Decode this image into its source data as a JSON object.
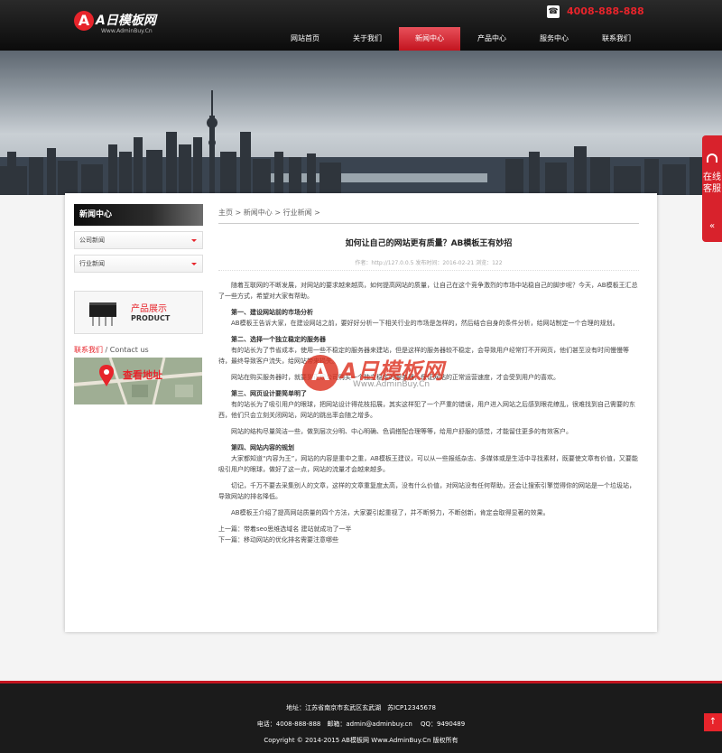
{
  "header": {
    "logo_mark": "A",
    "logo_name": "A日模板网",
    "logo_url": "Www.AdminBuy.Cn",
    "phone": "4008-888-888",
    "nav": [
      "网站首页",
      "关于我们",
      "新闻中心",
      "产品中心",
      "服务中心",
      "联系我们"
    ],
    "nav_active_index": 2
  },
  "sidebar": {
    "title": "新闻中心",
    "items": [
      "公司新闻",
      "行业新闻"
    ],
    "product_label_cn": "产品展示",
    "product_label_en": "PRODUCT",
    "contact_red": "联系我们",
    "contact_rest": " / Contact us",
    "map_label": "查看地址"
  },
  "article": {
    "breadcrumb": "主页 > 新闻中心 > 行业新闻 >",
    "title": "如何让自己的网站更有质量？AB模板王有妙招",
    "meta": "作者：http://127.0.0.5  发布时间：2016-02-21  浏览：122",
    "paragraphs": [
      "随着互联网的不断发展，对网站的要求越来越高，如何提高网站的质量，让自己在这个竞争激烈的市场中站稳自己的脚步呢？今天，AB模板王汇总了一些方式，希望对大家有帮助。",
      "第一、建设网站前的市场分析",
      "AB模板王告诉大家，在建设网站之前，要好好分析一下相关行业的市场是怎样的，然后结合自身的条件分析，给网站制定一个合理的规划。",
      "第二、选择一个独立稳定的服务器",
      "有的站长为了节省成本，使用一些不稳定的服务器来建站，但是这样的服务器较不稳定，会导致用户经常打不开网页，他们甚至没有时间慢慢等待，最终导致客户流失，给网站带来损失。",
      "网站在购买服务器时，就要到正规公司购买一个独立稳定的服务器，保证网站的正常运营速度，才会受到用户的喜欢。",
      "第三、网页设计要简单明了",
      "有的站长为了吸引用户的眼球，把网站设计得花枝招展，其实这样犯了一个严重的错误，用户进入网站之后感到眼花缭乱，很难找到自己需要的东西，他们只会立刻关闭网站，网站的跳出率会随之增多。",
      "网站的结构尽量简洁一些，做到层次分明、中心明确、色调搭配合理等等，给用户舒服的感觉，才能留住更多的有效客户。",
      "第四、网站内容的规划",
      "大家都知道“内容为王”，网站的内容是重中之重，AB模板王建议，可以从一些报纸杂志、多媒体或是生活中寻找素材，既要使文章有价值，又要能吸引用户的眼球，做好了这一点，网站的流量才会越来越多。",
      "切记，千万不要去采集别人的文章，这样的文章重复度太高，没有什么价值，对网站没有任何帮助，还会让搜索引擎觉得你的网站是一个垃圾站，导致网站的排名降低。",
      "AB模板王介绍了提高网站质量的四个方法，大家要引起重视了，并不断努力，不断创新，肯定会取得显著的效果。"
    ],
    "prev": "上一篇：带着seo思维选域名 建站就成功了一半",
    "next": "下一篇：移动网站的优化排名需要注意哪些"
  },
  "watermark": {
    "mark": "A",
    "name": "A日模板网",
    "url": "Www.AdminBuy.Cn"
  },
  "float_service": {
    "text": "在线客服",
    "arrow": "«"
  },
  "to_top": "↑",
  "footer": {
    "address": "地址：江苏省南京市玄武区玄武湖　苏ICP12345678",
    "contact": "电话：4008-888-888　邮箱：admin@adminbuy.cn　 QQ：9490489",
    "copyright": "Copyright © 2014-2015 AB模板网 Www.AdminBuy.Cn 版权所有"
  },
  "colors": {
    "accent": "#e7242b",
    "header_bg": "#1a1a1a",
    "footer_bg": "#1b1b1b"
  }
}
